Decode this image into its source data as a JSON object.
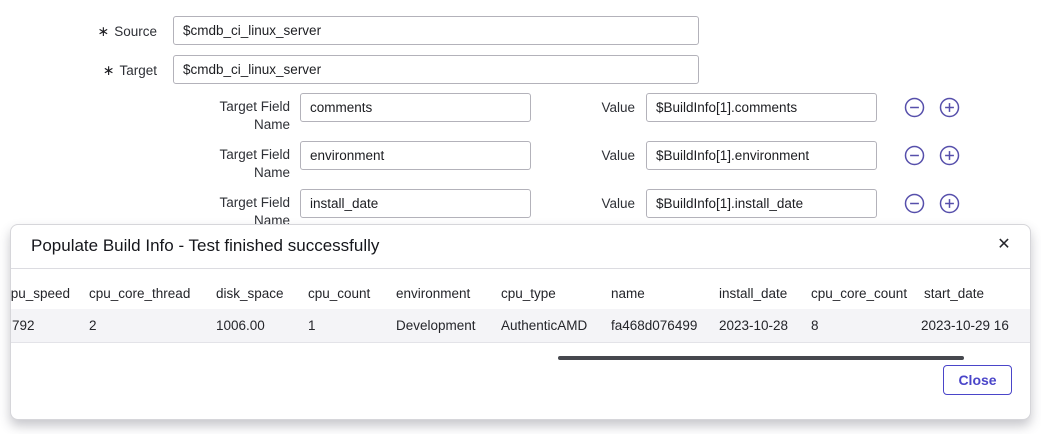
{
  "form": {
    "required_marker": "∗",
    "source": {
      "label": "Source",
      "value": "$cmdb_ci_linux_server"
    },
    "target": {
      "label": "Target",
      "value": "$cmdb_ci_linux_server"
    },
    "mappings": {
      "field_label_line1": "Target Field",
      "field_label_line2": "Name",
      "value_label": "Value",
      "rows": [
        {
          "field": "comments",
          "value": "$BuildInfo[1].comments"
        },
        {
          "field": "environment",
          "value": "$BuildInfo[1].environment"
        },
        {
          "field": "install_date",
          "value": "$BuildInfo[1].install_date"
        }
      ]
    }
  },
  "modal": {
    "title": "Populate Build Info - Test finished successfully",
    "close_icon": "✕",
    "close_button_label": "Close",
    "table": {
      "columns": [
        "cpu_speed",
        "cpu_core_thread",
        "disk_space",
        "cpu_count",
        "environment",
        "cpu_type",
        "name",
        "install_date",
        "cpu_core_count",
        "start_date"
      ],
      "row": [
        "792",
        "2",
        "1006.00",
        "1",
        "Development",
        "AuthenticAMD",
        "fa468d076499",
        "2023-10-28",
        "8",
        "2023-10-29 16"
      ]
    }
  },
  "colors": {
    "accent": "#4a45c9",
    "row_icon": "#564fab",
    "scrollbar_thumb": "#46484e",
    "table_row_bg": "#f4f4f7"
  }
}
